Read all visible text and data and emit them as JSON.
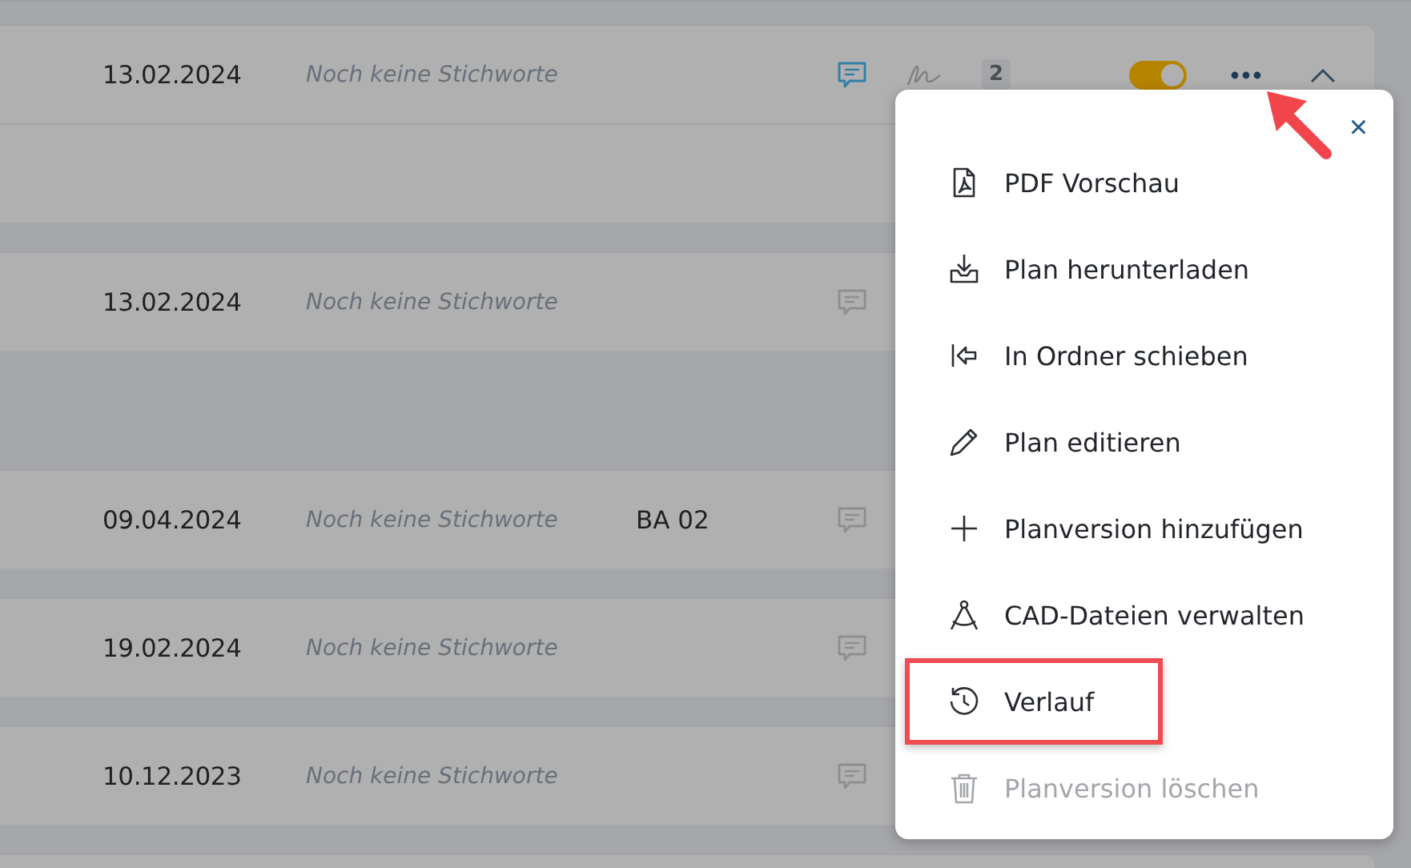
{
  "rows": [
    {
      "date": "13.02.2024",
      "keywords": "Noch keine Stichworte",
      "has_comments": true,
      "signature": true,
      "badge": "2",
      "toggle": {
        "on": true
      },
      "expanded": true
    },
    {
      "date": "13.02.2024",
      "keywords": "Noch keine Stichworte",
      "has_comments": false,
      "expanded": false
    },
    {
      "date": "09.04.2024",
      "keywords": "Noch keine Stichworte",
      "column_3": "BA 02",
      "has_comments": false,
      "expanded": false
    },
    {
      "date": "19.02.2024",
      "keywords": "Noch keine Stichworte",
      "has_comments": false,
      "expanded": false
    },
    {
      "date": "10.12.2023",
      "keywords": "Noch keine Stichworte",
      "has_comments": false,
      "expanded": false
    }
  ],
  "menu": {
    "close": "×",
    "items": [
      {
        "kind": "pdf",
        "label": "PDF Vorschau",
        "disabled": false,
        "highlighted": false
      },
      {
        "kind": "download",
        "label": "Plan herunterladen",
        "disabled": false,
        "highlighted": false
      },
      {
        "kind": "move",
        "label": "In Ordner schieben",
        "disabled": false,
        "highlighted": false
      },
      {
        "kind": "edit",
        "label": "Plan editieren",
        "disabled": false,
        "highlighted": false
      },
      {
        "kind": "add",
        "label": "Planversion hinzufügen",
        "disabled": false,
        "highlighted": false
      },
      {
        "kind": "cad",
        "label": "CAD-Dateien verwalten",
        "disabled": false,
        "highlighted": false
      },
      {
        "kind": "history",
        "label": "Verlauf",
        "disabled": false,
        "highlighted": true
      },
      {
        "kind": "delete",
        "label": "Planversion löschen",
        "disabled": true,
        "highlighted": false
      }
    ]
  }
}
